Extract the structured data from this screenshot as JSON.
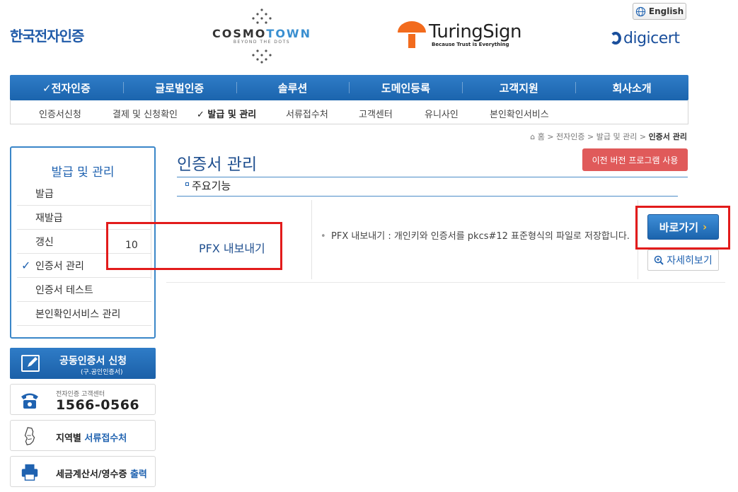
{
  "header": {
    "logo_crosscert": "한국전자인증",
    "logo_cosmotown": {
      "name_a": "COSMO",
      "name_b": "TOWN",
      "tagline": "BEYOND THE DOTS"
    },
    "logo_turingsign": {
      "name": "TuringSign",
      "tagline": "Because Trust is Everything"
    },
    "logo_digicert": "digicert",
    "english_button": "English"
  },
  "gnb": {
    "items": [
      "✓전자인증",
      "글로벌인증",
      "솔루션",
      "도메인등록",
      "고객지원",
      "회사소개"
    ]
  },
  "lnb": {
    "items": [
      "인증서신청",
      "결제 및 신청확인",
      "✓ 발급 및 관리",
      "서류접수처",
      "고객센터",
      "유니사인",
      "본인확인서비스"
    ]
  },
  "breadcrumb": {
    "home": "홈",
    "path": "> 전자인증 > 발급 및 관리 >",
    "current": "인증서 관리"
  },
  "sidebar": {
    "title": "발급 및 관리",
    "items": [
      {
        "label": "발급"
      },
      {
        "label": "재발급"
      },
      {
        "label": "갱신"
      },
      {
        "label": "인증서 관리",
        "check": "✓"
      },
      {
        "label": "인증서 테스트"
      },
      {
        "label": "본인확인서비스 관리"
      }
    ]
  },
  "side_banners": {
    "apply_title": "공동인증서 신청",
    "apply_sub": "(구.공인인증서)",
    "phone_label": "전자인증 고객센터",
    "phone_number": "1566-0566",
    "region_plain": "지역별 ",
    "region_accent": "서류접수처",
    "invoice_plain": "세금계산서/영수증 ",
    "invoice_accent": "출력"
  },
  "content": {
    "page_title": "인증서 관리",
    "old_version_button": "이전 버전 프로그램 사용",
    "section_title": "주요기능",
    "row": {
      "number": "10",
      "name": "PFX 내보내기",
      "bullet": "•",
      "description": "PFX 내보내기 : 개인키와 인증서를 pkcs#12 표준형식의 파일로 저장합니다.",
      "go_button": "바로가기",
      "go_arrow": "›",
      "detail_button": "자세히보기"
    }
  },
  "colors": {
    "primary": "#1f62b0",
    "highlight": "#e21b1b",
    "old_version": "#e05a5a"
  }
}
